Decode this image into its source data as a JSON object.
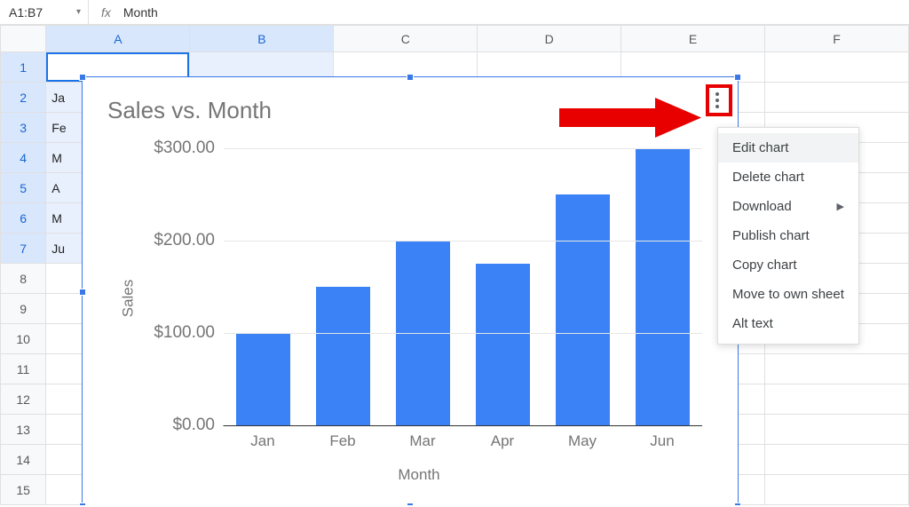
{
  "formula_bar": {
    "cell_ref": "A1:B7",
    "fx_label": "fx",
    "content": "Month"
  },
  "columns": [
    "A",
    "B",
    "C",
    "D",
    "E",
    "F"
  ],
  "visible_row_count": 15,
  "selected_cols": [
    "A",
    "B"
  ],
  "selected_rows": [
    1,
    2,
    3,
    4,
    5,
    6,
    7
  ],
  "active_cell": {
    "row": 1,
    "col": "A"
  },
  "cells": {
    "A2": "Ja",
    "A3": "Fe",
    "A4": "M",
    "A5": "A",
    "A6": "M",
    "A7": "Ju"
  },
  "chart_title": "Sales vs. Month",
  "context_menu": {
    "items": [
      {
        "label": "Edit chart",
        "submenu": false,
        "hovered": true
      },
      {
        "label": "Delete chart",
        "submenu": false
      },
      {
        "label": "Download",
        "submenu": true
      },
      {
        "label": "Publish chart",
        "submenu": false
      },
      {
        "label": "Copy chart",
        "submenu": false
      },
      {
        "label": "Move to own sheet",
        "submenu": false
      },
      {
        "label": "Alt text",
        "submenu": false
      }
    ]
  },
  "chart_data": {
    "type": "bar",
    "title": "Sales vs. Month",
    "categories": [
      "Jan",
      "Feb",
      "Mar",
      "Apr",
      "May",
      "Jun"
    ],
    "values": [
      100,
      150,
      200,
      175,
      250,
      300
    ],
    "xlabel": "Month",
    "ylabel": "Sales",
    "ylim": [
      0,
      300
    ],
    "y_ticks": [
      0,
      100,
      200,
      300
    ],
    "y_tick_labels": [
      "$0.00",
      "$100.00",
      "$200.00",
      "$300.00"
    ],
    "value_format": "currency_usd"
  }
}
